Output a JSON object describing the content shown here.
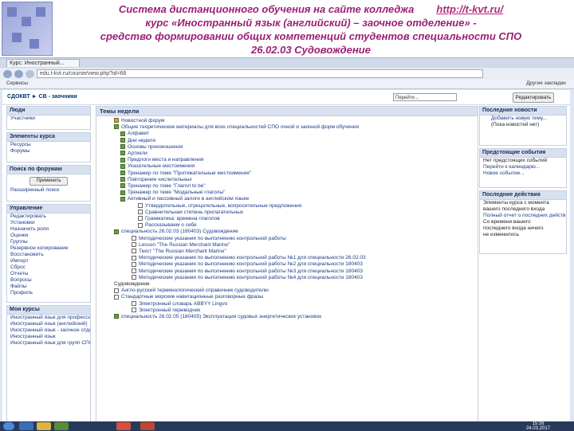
{
  "header": {
    "line1": "Система дистанционного обучения на сайте колледжа",
    "url": "http://t-kvt.ru/",
    "line2": "курс «Иностранный язык (английский) – заочное отделение» -",
    "line3": "средство формировании общих компетенций студентов специальности СПО",
    "line4": "26.02.03 Судовождение"
  },
  "browser": {
    "tab_title": "Курс: Иностранный...",
    "address": "edu.t-kvt.ru/course/view.php?id=66",
    "bookmarks": [
      "Сервисы",
      "Другие закладки"
    ]
  },
  "page": {
    "breadcrumb": "СДОКВТ ► СВ - заочники",
    "jump_select": "Перейти...",
    "edit_button": "Редактировать"
  },
  "left_blocks": {
    "people": {
      "title": "Люди",
      "items": [
        "Участники"
      ]
    },
    "elements": {
      "title": "Элементы курса",
      "items": [
        "Ресурсы",
        "Форумы"
      ]
    },
    "search": {
      "title": "Поиск по форумам",
      "button": "Применить",
      "advanced": "Расширенный поиск"
    },
    "admin": {
      "title": "Управление",
      "items": [
        "Редактировать",
        "Установки",
        "Назначить роли",
        "Оценки",
        "Группы",
        "Резервное копирование",
        "Восстановить",
        "Импорт",
        "Сброс",
        "Отчеты",
        "Вопросы",
        "Файлы",
        "Профиль"
      ]
    },
    "mycourses": {
      "title": "Мои курсы",
      "items": [
        "Иностранный язык для профессии",
        "Иностранный язык (английский)",
        "Иностранный язык - заочное отделение",
        "Иностранный язык",
        "Иностранный язык для групп СПО"
      ]
    }
  },
  "center": {
    "title": "Темы недели",
    "lines": [
      "Новостной форум",
      "Общие теоретические материалы для всех специальностей СПО очной и заочной форм обучения",
      "Алфавит",
      "Дни недели",
      "Основы произношения",
      "Артикли",
      "Предлоги места и направления",
      "Указательные местоимения",
      "Тренажер по теме \"Притяжательные местоимения\"",
      "Повторение числительных",
      "Тренажер по теме \"Глагол to be\"",
      "Тренажер по теме \"Модальные глаголы\"",
      "Активный и пассивный залоги в английском языке",
      "Утвердительные, отрицательные, вопросительные предложения",
      "Сравнительная степень прилагательных",
      "Грамматика: времена глаголов",
      "Рассказываем о себе",
      "специальность 26.02.03 (180403) Судовождение",
      "Методические указания по выполнению контрольной работы",
      "Lesson \"The Russian Merchant Marine\"",
      "Текст \"The Russian Merchant Marine\"",
      "Методические указания по выполнению контрольной работы №1 для специальности 26.02.03",
      "Методические указания по выполнению контрольной работы №2 для специальности 180403",
      "Методические указания по выполнению контрольной работы №3 для специальности 180403",
      "Методические указания по выполнению контрольной работы №4 для специальности 180403",
      "Судовождение",
      "Англо-русский терминологический справочник судоводителю",
      "Стандартные морские навигационные разговорные фразы",
      "Электронный словарь ABBYY Lingvo",
      "Электронный переводчик",
      "специальность 26.02.05 (180405) Эксплуатация судовых энергетических установок"
    ]
  },
  "right_blocks": {
    "news": {
      "title": "Последние новости",
      "items": [
        "Добавить новую тему...",
        "(Пока новостей нет)"
      ]
    },
    "events": {
      "title": "Предстоящие события",
      "items": [
        "Нет предстоящих событий",
        "Перейти к календарю...",
        "Новое событие..."
      ]
    },
    "recent": {
      "title": "Последние действия",
      "items": [
        "Элементы курса с момента",
        "вашего последнего входа",
        "Полный отчет о последних действиях",
        "Со времени вашего",
        "последнего входа ничего",
        "не изменилось"
      ]
    }
  },
  "taskbar": {
    "time": "15:16",
    "date": "24.03.2017"
  }
}
